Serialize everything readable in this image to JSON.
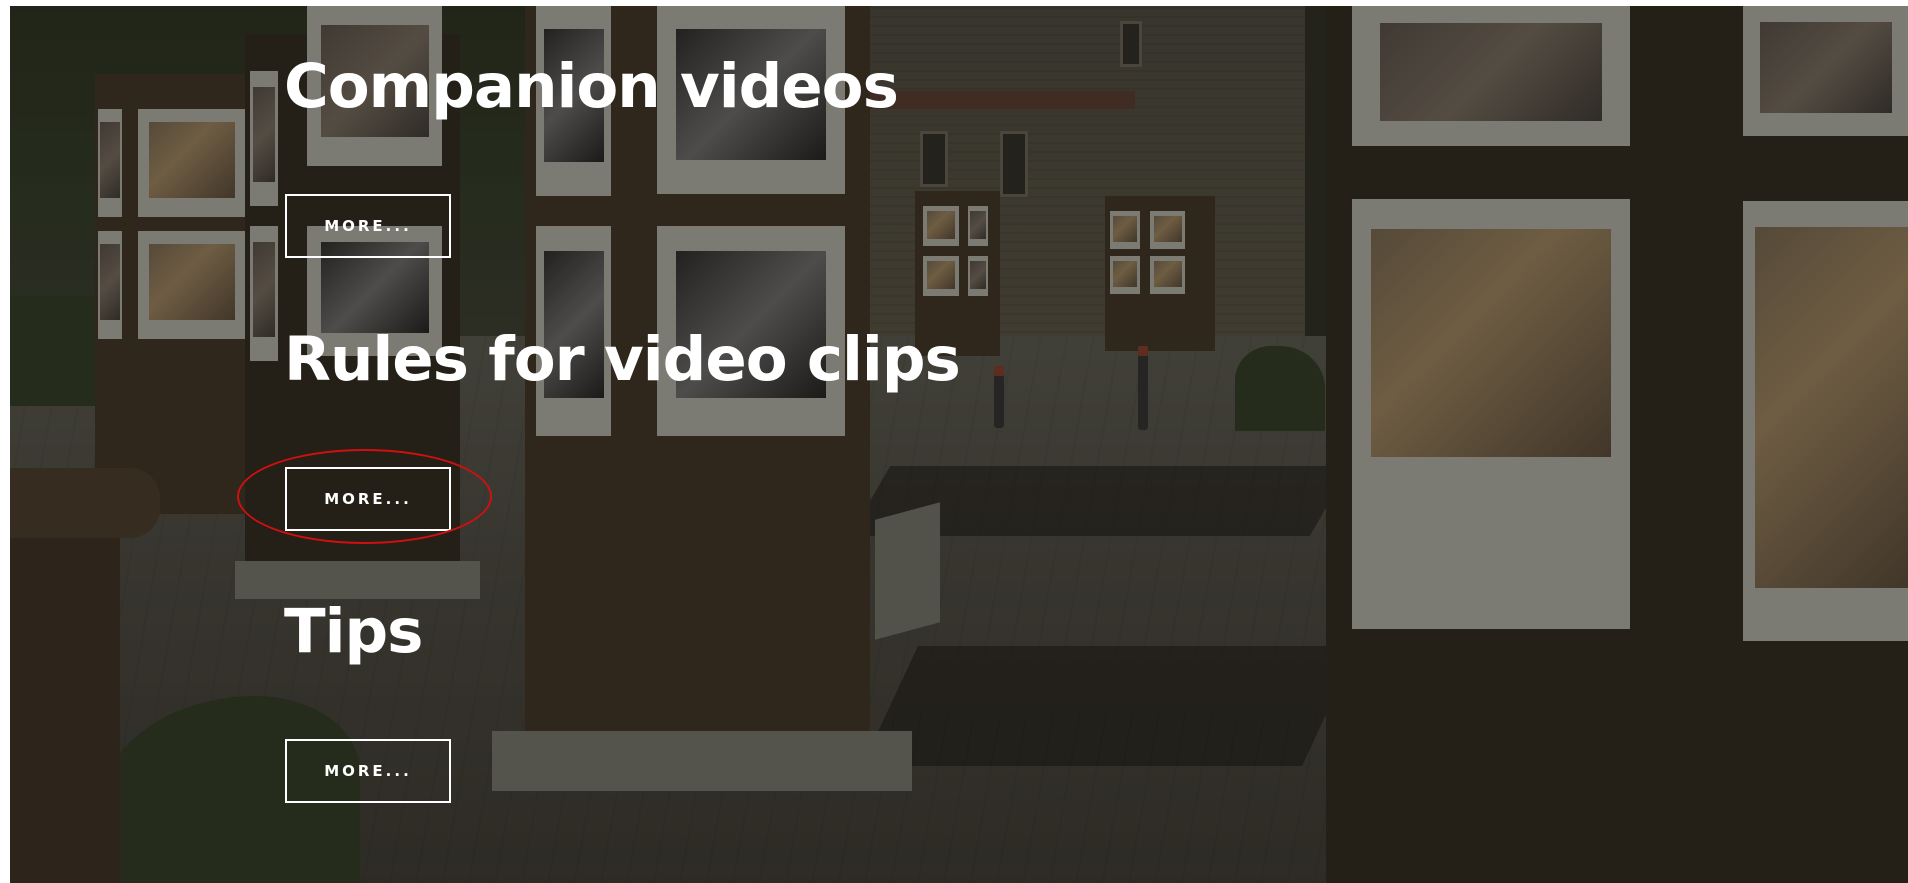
{
  "sections": [
    {
      "heading": "Companion videos",
      "button_label": "MORE..."
    },
    {
      "heading": "Rules for video clips",
      "button_label": "MORE..."
    },
    {
      "heading": "Tips",
      "button_label": "MORE..."
    }
  ],
  "background": {
    "description_icon": "photo-exhibition-background",
    "overlay_color": "#181610"
  },
  "annotation": {
    "highlight_color": "#d01010"
  },
  "colors": {
    "heading_text": "#ffffff",
    "button_border": "#ffffff",
    "button_text": "#ffffff"
  }
}
